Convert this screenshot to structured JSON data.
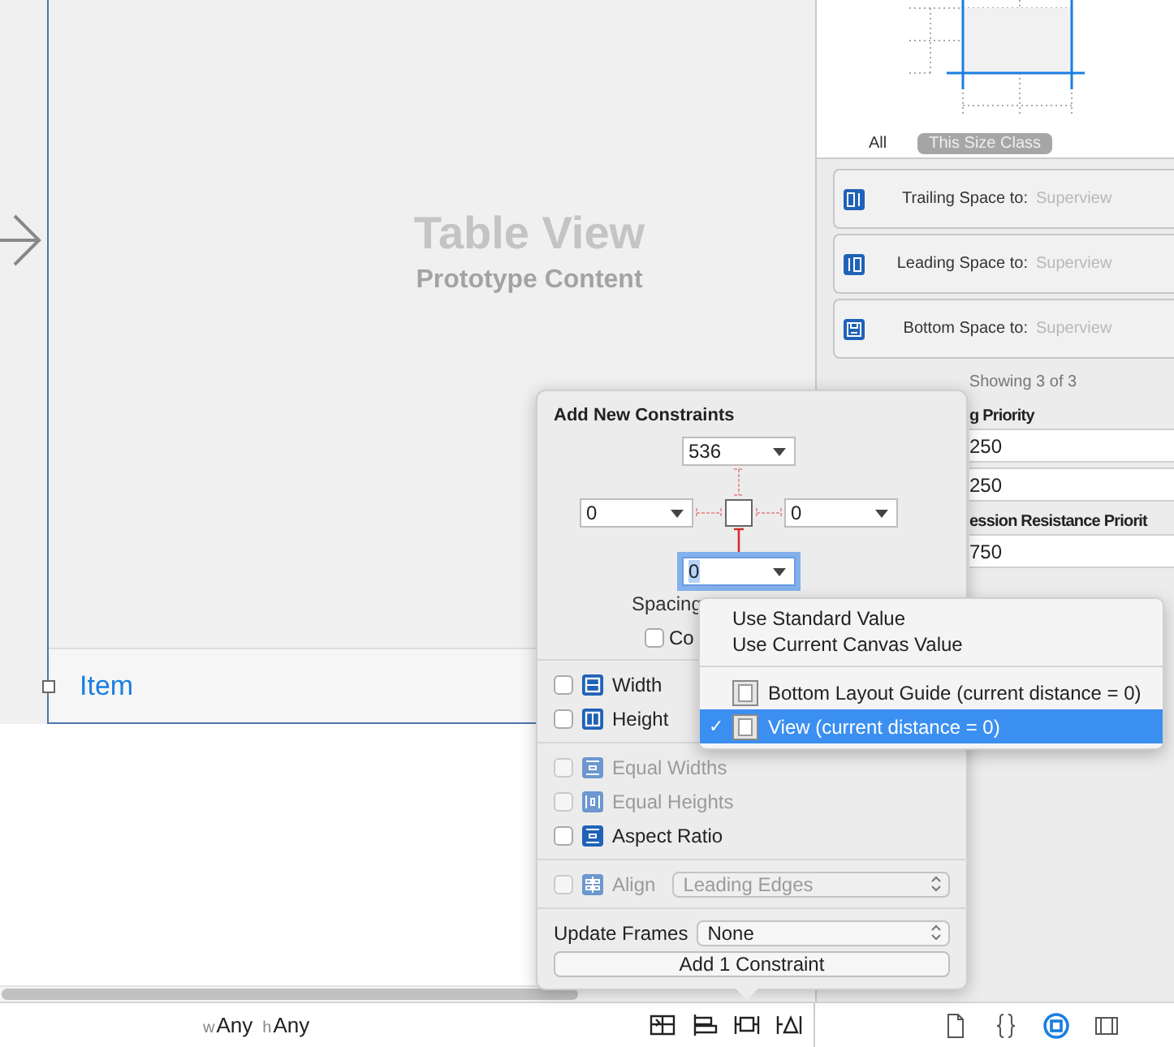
{
  "canvas": {
    "table_view": {
      "title": "Table View",
      "subtitle": "Prototype Content"
    },
    "cell": {
      "label": "Item"
    }
  },
  "size_class_tabs": [
    {
      "label": "All",
      "selected": false
    },
    {
      "label": "This Size Class",
      "selected": true
    }
  ],
  "constraints": [
    {
      "kind": "trailing",
      "label": "Trailing Space to:",
      "target": "Superview"
    },
    {
      "kind": "leading",
      "label": "Leading Space to:",
      "target": "Superview"
    },
    {
      "kind": "bottom",
      "label": "Bottom Space to:",
      "target": "Superview"
    }
  ],
  "showing": "Showing 3 of 3",
  "priority_sections": [
    {
      "heading": "g Priority",
      "values": [
        "250",
        "250"
      ]
    },
    {
      "heading": "ession Resistance Priorit",
      "values": [
        "750"
      ]
    }
  ],
  "popover": {
    "title": "Add New Constraints",
    "spacing_fields": [
      {
        "kind": "top",
        "value": "536",
        "focused": false
      },
      {
        "kind": "left",
        "value": "0",
        "focused": false
      },
      {
        "kind": "right",
        "value": "0",
        "focused": false
      },
      {
        "kind": "bottom",
        "value": "0",
        "focused": true
      }
    ],
    "spacing_label": "Spacing",
    "constrain_checkbox": {
      "label": "Co",
      "checked": false
    },
    "rows": [
      {
        "kind": "width",
        "label": "Width",
        "checked": false,
        "disabled": false
      },
      {
        "kind": "height",
        "label": "Height",
        "checked": false,
        "disabled": false
      },
      {
        "kind": "equal-widths",
        "label": "Equal Widths",
        "checked": false,
        "disabled": true
      },
      {
        "kind": "equal-heights",
        "label": "Equal Heights",
        "checked": false,
        "disabled": true
      },
      {
        "kind": "aspect",
        "label": "Aspect Ratio",
        "checked": false,
        "disabled": false
      }
    ],
    "align": {
      "label": "Align",
      "value": "Leading Edges",
      "checked": false,
      "disabled": true
    },
    "update_frames": {
      "label": "Update Frames",
      "value": "None"
    },
    "button": "Add 1 Constraint"
  },
  "menu": [
    {
      "kind": "plain",
      "label": "Use Standard Value",
      "selected": false
    },
    {
      "kind": "plain",
      "label": "Use Current Canvas Value",
      "selected": false
    },
    {
      "kind": "target",
      "label": "Bottom Layout Guide (current distance = 0)",
      "selected": false
    },
    {
      "kind": "target",
      "label": "View (current distance = 0)",
      "selected": true
    }
  ],
  "menu_checkmark": "✓",
  "size_class": [
    {
      "prefix": "w",
      "value": "Any"
    },
    {
      "prefix": "h",
      "value": "Any"
    }
  ],
  "inspector_tabs": [
    {
      "kind": "file",
      "selected": false
    },
    {
      "kind": "braces",
      "selected": false
    },
    {
      "kind": "circle",
      "selected": true
    },
    {
      "kind": "panel",
      "selected": false
    }
  ]
}
